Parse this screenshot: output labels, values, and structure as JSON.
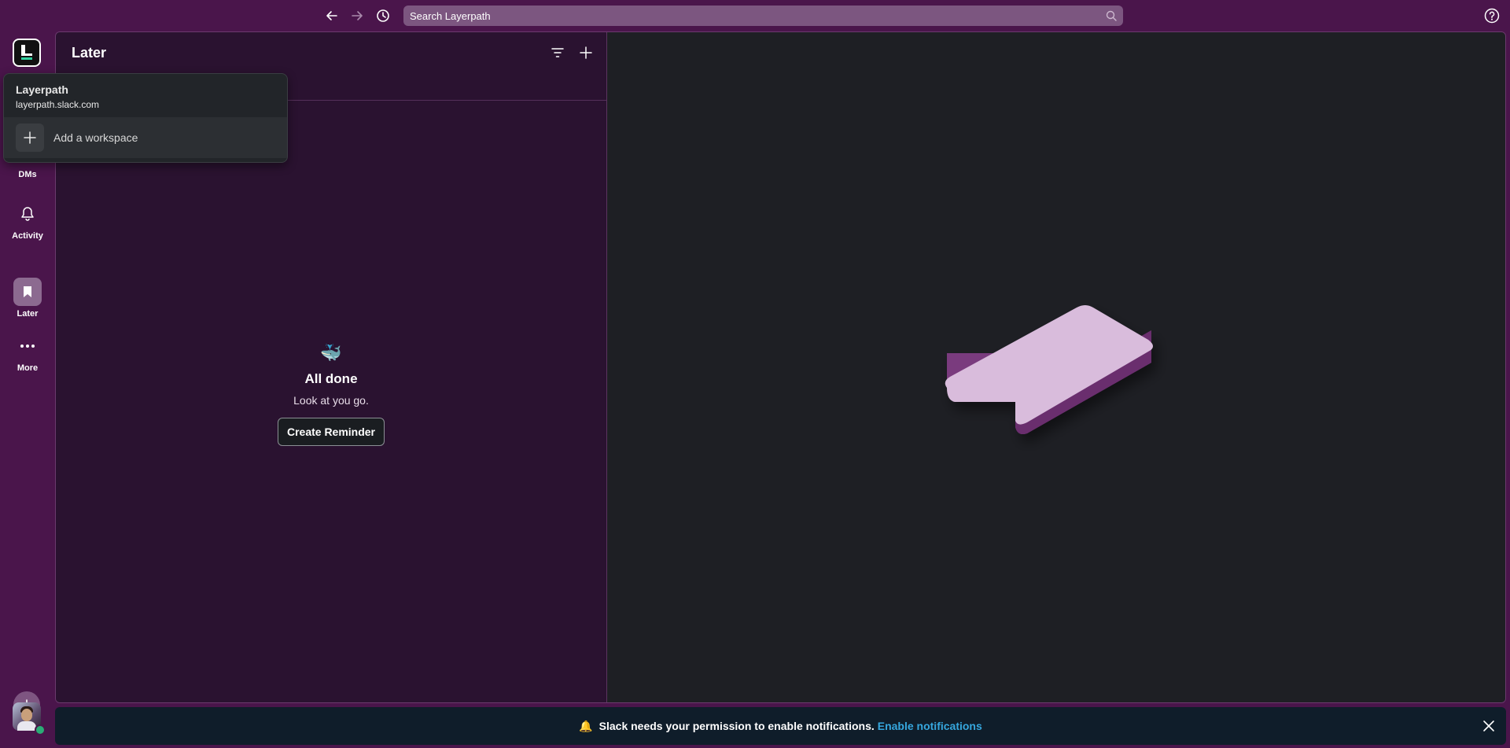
{
  "topbar": {
    "search_placeholder": "Search Layerpath"
  },
  "rail": {
    "items": [
      {
        "label": "DMs"
      },
      {
        "label": "Activity"
      },
      {
        "label": "Later"
      },
      {
        "label": "More"
      }
    ]
  },
  "later": {
    "title": "Later",
    "empty_emoji": "🐳",
    "empty_title": "All done",
    "empty_subtitle": "Look at you go.",
    "create_button": "Create Reminder"
  },
  "workspace_menu": {
    "name": "Layerpath",
    "url": "layerpath.slack.com",
    "add_label": "Add a workspace"
  },
  "notification": {
    "bell": "🔔",
    "message": "Slack needs your permission to enable notifications.",
    "link": "Enable notifications"
  },
  "colors": {
    "aubergine": "#4a154b",
    "pane": "#2a1230",
    "right_pane": "#1e1f24",
    "link": "#36a7de",
    "online": "#2bac76"
  }
}
